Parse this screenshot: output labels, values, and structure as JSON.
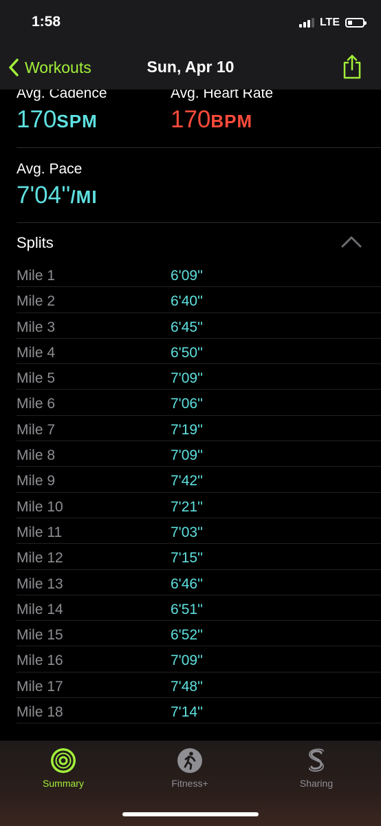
{
  "status_bar": {
    "time": "1:58",
    "network": "LTE",
    "signal_bars": 3,
    "battery_level": 0.25
  },
  "nav": {
    "back_label": "Workouts",
    "title": "Sun, Apr 10",
    "share_icon": "share-icon"
  },
  "metrics": {
    "cadence": {
      "label": "Avg. Cadence",
      "value": "170",
      "unit": "SPM"
    },
    "heart_rate": {
      "label": "Avg. Heart Rate",
      "value": "170",
      "unit": "BPM"
    },
    "pace": {
      "label": "Avg. Pace",
      "value": "7'04''",
      "unit": "/MI"
    }
  },
  "splits": {
    "title": "Splits",
    "rows": [
      {
        "mile": "Mile 1",
        "pace": "6'09''"
      },
      {
        "mile": "Mile 2",
        "pace": "6'40''"
      },
      {
        "mile": "Mile 3",
        "pace": "6'45''"
      },
      {
        "mile": "Mile 4",
        "pace": "6'50''"
      },
      {
        "mile": "Mile 5",
        "pace": "7'09''"
      },
      {
        "mile": "Mile 6",
        "pace": "7'06''"
      },
      {
        "mile": "Mile 7",
        "pace": "7'19''"
      },
      {
        "mile": "Mile 8",
        "pace": "7'09''"
      },
      {
        "mile": "Mile 9",
        "pace": "7'42''"
      },
      {
        "mile": "Mile 10",
        "pace": "7'21''"
      },
      {
        "mile": "Mile 11",
        "pace": "7'03''"
      },
      {
        "mile": "Mile 12",
        "pace": "7'15''"
      },
      {
        "mile": "Mile 13",
        "pace": "6'46''"
      },
      {
        "mile": "Mile 14",
        "pace": "6'51''"
      },
      {
        "mile": "Mile 15",
        "pace": "6'52''"
      },
      {
        "mile": "Mile 16",
        "pace": "7'09''"
      },
      {
        "mile": "Mile 17",
        "pace": "7'48''"
      },
      {
        "mile": "Mile 18",
        "pace": "7'14''"
      }
    ]
  },
  "tabs": [
    {
      "label": "Summary",
      "icon": "activity-rings-icon",
      "active": true
    },
    {
      "label": "Fitness+",
      "icon": "runner-icon",
      "active": false
    },
    {
      "label": "Sharing",
      "icon": "sharing-icon",
      "active": false
    }
  ],
  "colors": {
    "accent": "#a3f03a",
    "metric_cyan": "#5fe0e0",
    "metric_red": "#ff4b3b",
    "background": "#000000"
  }
}
